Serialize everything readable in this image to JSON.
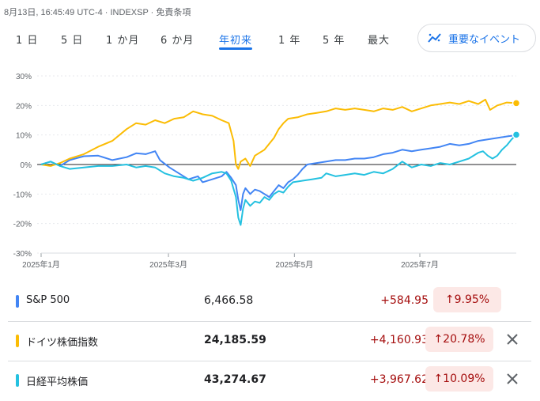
{
  "header": {
    "info": "8月13日, 16:45:49 UTC-4 · INDEXSP · 免責条項"
  },
  "tabs": [
    {
      "label": "1 日"
    },
    {
      "label": "5 日"
    },
    {
      "label": "1 か月"
    },
    {
      "label": "6 か月"
    },
    {
      "label": "年初来",
      "active": true
    },
    {
      "label": "1 年"
    },
    {
      "label": "5 年"
    },
    {
      "label": "最大"
    }
  ],
  "events_button": {
    "label": "重要なイベント",
    "icon": "sparkline-icon"
  },
  "chart_data": {
    "type": "line",
    "y_ticks": [
      "30%",
      "20%",
      "10%",
      "0%",
      "-10%",
      "-20%",
      "-30%"
    ],
    "ylim": [
      -30,
      30
    ],
    "x_ticks": [
      {
        "label": "2025年1月",
        "t": 0
      },
      {
        "label": "2025年3月",
        "t": 0.268
      },
      {
        "label": "2025年5月",
        "t": 0.533
      },
      {
        "label": "2025年7月",
        "t": 0.797
      }
    ],
    "grid": true,
    "series": [
      {
        "name": "S&P 500",
        "color": "#4285f4",
        "values": [
          [
            0,
            0
          ],
          [
            0.02,
            1
          ],
          [
            0.04,
            -0.5
          ],
          [
            0.06,
            1.5
          ],
          [
            0.09,
            2.8
          ],
          [
            0.12,
            3
          ],
          [
            0.15,
            1.5
          ],
          [
            0.18,
            2.5
          ],
          [
            0.2,
            3.8
          ],
          [
            0.22,
            3.5
          ],
          [
            0.24,
            4.5
          ],
          [
            0.25,
            1.5
          ],
          [
            0.27,
            -1
          ],
          [
            0.29,
            -3
          ],
          [
            0.31,
            -5
          ],
          [
            0.33,
            -4
          ],
          [
            0.34,
            -6
          ],
          [
            0.36,
            -5
          ],
          [
            0.38,
            -4
          ],
          [
            0.39,
            -2.5
          ],
          [
            0.4,
            -4.5
          ],
          [
            0.41,
            -7
          ],
          [
            0.415,
            -12
          ],
          [
            0.42,
            -15.5
          ],
          [
            0.425,
            -10
          ],
          [
            0.43,
            -8
          ],
          [
            0.44,
            -10
          ],
          [
            0.45,
            -8.5
          ],
          [
            0.46,
            -9
          ],
          [
            0.47,
            -10
          ],
          [
            0.48,
            -11
          ],
          [
            0.49,
            -9
          ],
          [
            0.5,
            -7
          ],
          [
            0.51,
            -8
          ],
          [
            0.52,
            -6
          ],
          [
            0.53,
            -5
          ],
          [
            0.54,
            -3.5
          ],
          [
            0.55,
            -1.5
          ],
          [
            0.56,
            0
          ],
          [
            0.58,
            0.5
          ],
          [
            0.6,
            1
          ],
          [
            0.62,
            1.5
          ],
          [
            0.64,
            1.5
          ],
          [
            0.66,
            2
          ],
          [
            0.68,
            2
          ],
          [
            0.7,
            2.5
          ],
          [
            0.72,
            3.5
          ],
          [
            0.74,
            4
          ],
          [
            0.76,
            5
          ],
          [
            0.78,
            4.5
          ],
          [
            0.8,
            5
          ],
          [
            0.82,
            5.5
          ],
          [
            0.84,
            6
          ],
          [
            0.86,
            7
          ],
          [
            0.88,
            6.5
          ],
          [
            0.9,
            7
          ],
          [
            0.92,
            8
          ],
          [
            0.94,
            8.5
          ],
          [
            0.96,
            9
          ],
          [
            0.98,
            9.5
          ],
          [
            1,
            9.95
          ]
        ]
      },
      {
        "name": "ドイツ株価指数",
        "color": "#fbbc04",
        "values": [
          [
            0,
            0
          ],
          [
            0.02,
            -0.5
          ],
          [
            0.04,
            0.5
          ],
          [
            0.06,
            2
          ],
          [
            0.09,
            3.5
          ],
          [
            0.12,
            6
          ],
          [
            0.15,
            8
          ],
          [
            0.18,
            12
          ],
          [
            0.2,
            14
          ],
          [
            0.22,
            13.5
          ],
          [
            0.24,
            15
          ],
          [
            0.26,
            14
          ],
          [
            0.28,
            15.5
          ],
          [
            0.3,
            16
          ],
          [
            0.32,
            18
          ],
          [
            0.34,
            17
          ],
          [
            0.36,
            16.5
          ],
          [
            0.38,
            15
          ],
          [
            0.395,
            14
          ],
          [
            0.405,
            8
          ],
          [
            0.41,
            0
          ],
          [
            0.415,
            -1.5
          ],
          [
            0.42,
            1
          ],
          [
            0.43,
            2
          ],
          [
            0.44,
            -0.5
          ],
          [
            0.45,
            3
          ],
          [
            0.47,
            5
          ],
          [
            0.49,
            9
          ],
          [
            0.5,
            12
          ],
          [
            0.51,
            14
          ],
          [
            0.52,
            15.5
          ],
          [
            0.54,
            16
          ],
          [
            0.56,
            17
          ],
          [
            0.58,
            17.5
          ],
          [
            0.6,
            18
          ],
          [
            0.62,
            19
          ],
          [
            0.64,
            18.5
          ],
          [
            0.66,
            19
          ],
          [
            0.68,
            18.5
          ],
          [
            0.7,
            18
          ],
          [
            0.72,
            19
          ],
          [
            0.74,
            18.5
          ],
          [
            0.76,
            19.5
          ],
          [
            0.78,
            18
          ],
          [
            0.8,
            19
          ],
          [
            0.82,
            20
          ],
          [
            0.84,
            20.5
          ],
          [
            0.86,
            21
          ],
          [
            0.88,
            20.5
          ],
          [
            0.9,
            21.5
          ],
          [
            0.92,
            20.5
          ],
          [
            0.935,
            22
          ],
          [
            0.945,
            18.5
          ],
          [
            0.96,
            20
          ],
          [
            0.98,
            21
          ],
          [
            1,
            20.78
          ]
        ]
      },
      {
        "name": "日経平均株価",
        "color": "#24c1e0",
        "values": [
          [
            0,
            0
          ],
          [
            0.02,
            1
          ],
          [
            0.04,
            -0.5
          ],
          [
            0.06,
            -1.5
          ],
          [
            0.09,
            -1
          ],
          [
            0.12,
            -0.5
          ],
          [
            0.15,
            -0.5
          ],
          [
            0.18,
            0
          ],
          [
            0.2,
            -1
          ],
          [
            0.22,
            -0.5
          ],
          [
            0.24,
            -1
          ],
          [
            0.26,
            -3
          ],
          [
            0.28,
            -4
          ],
          [
            0.3,
            -4.5
          ],
          [
            0.32,
            -5.5
          ],
          [
            0.34,
            -4.5
          ],
          [
            0.36,
            -3
          ],
          [
            0.38,
            -2.5
          ],
          [
            0.39,
            -3
          ],
          [
            0.4,
            -5.5
          ],
          [
            0.41,
            -11
          ],
          [
            0.415,
            -18
          ],
          [
            0.42,
            -20.5
          ],
          [
            0.425,
            -15
          ],
          [
            0.43,
            -12
          ],
          [
            0.44,
            -14
          ],
          [
            0.45,
            -12.5
          ],
          [
            0.46,
            -13
          ],
          [
            0.47,
            -11
          ],
          [
            0.48,
            -12
          ],
          [
            0.49,
            -10
          ],
          [
            0.5,
            -9
          ],
          [
            0.51,
            -9.5
          ],
          [
            0.52,
            -7.5
          ],
          [
            0.53,
            -6
          ],
          [
            0.55,
            -5.5
          ],
          [
            0.57,
            -5
          ],
          [
            0.59,
            -4.5
          ],
          [
            0.6,
            -3
          ],
          [
            0.62,
            -4
          ],
          [
            0.64,
            -3.5
          ],
          [
            0.66,
            -3
          ],
          [
            0.68,
            -3.5
          ],
          [
            0.7,
            -2.5
          ],
          [
            0.72,
            -3
          ],
          [
            0.74,
            -1.5
          ],
          [
            0.76,
            1
          ],
          [
            0.78,
            -1
          ],
          [
            0.8,
            0
          ],
          [
            0.82,
            -0.5
          ],
          [
            0.84,
            0.5
          ],
          [
            0.86,
            0
          ],
          [
            0.88,
            1
          ],
          [
            0.9,
            2
          ],
          [
            0.92,
            4
          ],
          [
            0.93,
            4.5
          ],
          [
            0.94,
            3
          ],
          [
            0.95,
            2
          ],
          [
            0.96,
            3
          ],
          [
            0.97,
            5
          ],
          [
            0.98,
            6.5
          ],
          [
            0.99,
            8.5
          ],
          [
            1,
            10.09
          ]
        ]
      }
    ]
  },
  "indices": [
    {
      "name": "S&P 500",
      "color": "#4285f4",
      "price": "6,466.58",
      "bold": false,
      "change": "+584.95",
      "pct": "↑9.95%",
      "closable": false
    },
    {
      "name": "ドイツ株価指数",
      "color": "#fbbc04",
      "price": "24,185.59",
      "bold": true,
      "change": "+4,160.93",
      "pct": "↑20.78%",
      "closable": true
    },
    {
      "name": "日経平均株価",
      "color": "#24c1e0",
      "price": "43,274.67",
      "bold": true,
      "change": "+3,967.62",
      "pct": "↑10.09%",
      "closable": true
    }
  ]
}
